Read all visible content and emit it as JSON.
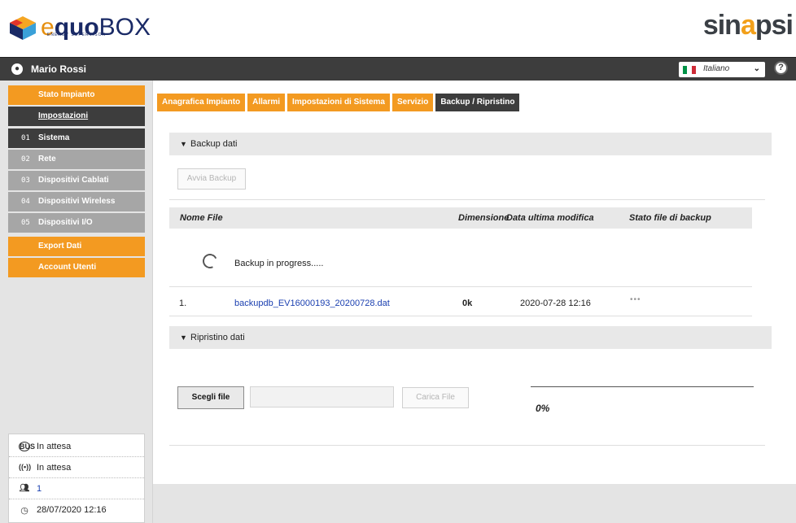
{
  "brand": {
    "logo_e": "e",
    "logo_quo": "quo",
    "logo_box": "BOX",
    "logo_sub": "ENERGY SUPERVISOR",
    "right_pre": "sin",
    "right_a": "a",
    "right_post": "psi"
  },
  "userbar": {
    "user_name": "Mario Rossi",
    "language": "Italiano",
    "flag_colors": [
      "#009246",
      "#ffffff",
      "#ce2b37"
    ]
  },
  "sidebar": {
    "items": [
      {
        "label": "Stato Impianto"
      },
      {
        "label": "Impostazioni"
      },
      {
        "num": "01",
        "label": "Sistema"
      },
      {
        "num": "02",
        "label": "Rete"
      },
      {
        "num": "03",
        "label": "Dispositivi Cablati"
      },
      {
        "num": "04",
        "label": "Dispositivi Wireless"
      },
      {
        "num": "05",
        "label": "Dispositivi I/O"
      },
      {
        "label": "Export Dati"
      },
      {
        "label": "Account Utenti"
      }
    ],
    "status": {
      "bus_status": "In attesa",
      "wireless_status": "In attesa",
      "users_count": "1",
      "datetime": "28/07/2020 12:16"
    }
  },
  "tabs": [
    {
      "label": "Anagrafica Impianto"
    },
    {
      "label": "Allarmi"
    },
    {
      "label": "Impostazioni di Sistema"
    },
    {
      "label": "Servizio"
    },
    {
      "label": "Backup / Ripristino"
    }
  ],
  "backup": {
    "section_title": "Backup dati",
    "start_button": "Avvia Backup",
    "columns": [
      "Nome File",
      "Dimensione",
      "Data ultima modifica",
      "Stato file di backup"
    ],
    "progress_text": "Backup in progress.....",
    "rows": [
      {
        "index": "1.",
        "file": "backupdb_EV16000193_20200728.dat",
        "size": "0k",
        "modified": "2020-07-28 12:16",
        "status": "•••"
      }
    ]
  },
  "restore": {
    "section_title": "Ripristino dati",
    "choose_button": "Scegli file",
    "upload_button": "Carica File",
    "progress": "0%"
  },
  "colors": {
    "accent": "#f39a21",
    "dark": "#3d3d3d",
    "link": "#1a3fb0"
  }
}
